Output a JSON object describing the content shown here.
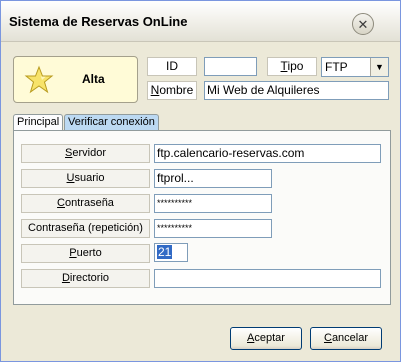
{
  "window": {
    "title": "Sistema de Reservas OnLine"
  },
  "header": {
    "alta_label": "Alta",
    "id_label": "ID",
    "id_value": "",
    "tipo_label": "Tipo",
    "tipo_value": "FTP",
    "nombre_label": "Nombre",
    "nombre_value": "Mi Web de Alquileres"
  },
  "tabs": [
    {
      "label": "Principal",
      "active": false
    },
    {
      "label": "Verificar conexión",
      "active": true
    }
  ],
  "form": {
    "servidor_label": "Servidor",
    "servidor_value": "ftp.calencario-reservas.com",
    "usuario_label": "Usuario",
    "usuario_value": "ftprol...",
    "contrasena_label": "Contraseña",
    "contrasena_value": "**********",
    "contrasena_rep_label": "Contraseña (repetición)",
    "contrasena_rep_value": "**********",
    "puerto_label": "Puerto",
    "puerto_value": "21",
    "directorio_label": "Directorio",
    "directorio_value": ""
  },
  "buttons": {
    "aceptar": "Aceptar",
    "cancelar": "Cancelar"
  },
  "icons": {
    "close": "close-icon",
    "alta": "star-icon",
    "dropdown": "chevron-down-icon"
  }
}
